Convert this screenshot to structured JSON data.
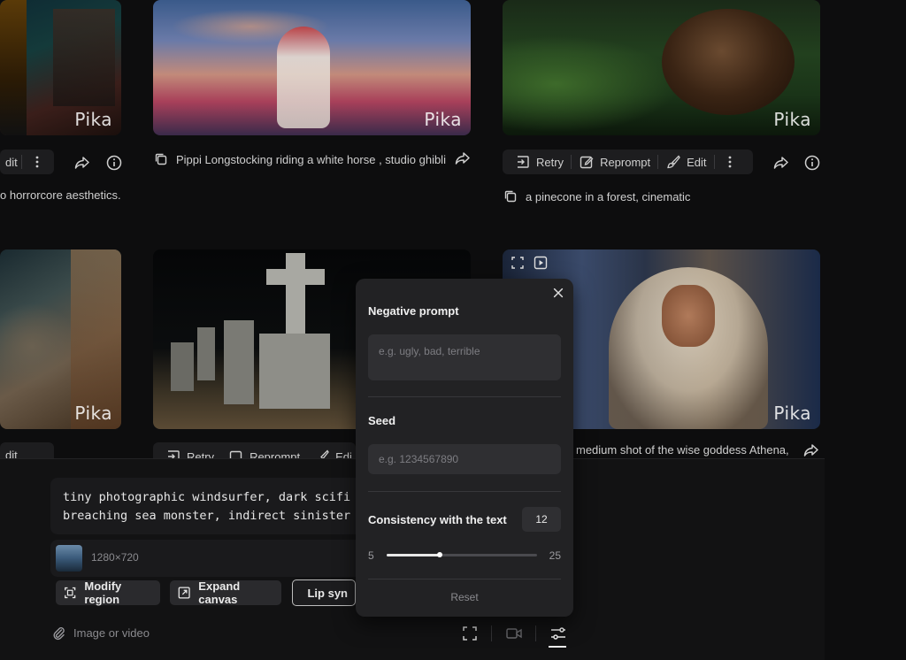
{
  "brand": {
    "watermark": "Pika"
  },
  "cards": {
    "left_top_caption": "o horrorcore aesthetics.",
    "left_top_edit": "dit",
    "middle_top_caption": "Pippi Longstocking riding a white horse , studio ghibli",
    "right_top_caption": "a pinecone in a forest, cinematic",
    "right_bottom_caption": "medium shot of the wise goddess Athena,",
    "left_bottom_edit": "dit"
  },
  "actions": {
    "retry": "Retry",
    "reprompt": "Reprompt",
    "edit": "Edit",
    "edit_partial": "Edi"
  },
  "composer": {
    "prompt": "tiny photographic windsurfer, dark scifi\nbreaching sea monster, indirect sinister",
    "resolution": "1280×720",
    "modify_region": "Modify region",
    "expand_canvas": "Expand canvas",
    "lip_sync": "Lip syn",
    "attach_label": "Image or video"
  },
  "settings_panel": {
    "negative_prompt_label": "Negative prompt",
    "negative_prompt_placeholder": "e.g. ugly, bad, terrible",
    "seed_label": "Seed",
    "seed_placeholder": "e.g. 1234567890",
    "consistency_label": "Consistency with the text",
    "consistency_value": "12",
    "slider_min": "5",
    "slider_max": "25",
    "slider_fraction": 0.35,
    "reset_label": "Reset"
  }
}
